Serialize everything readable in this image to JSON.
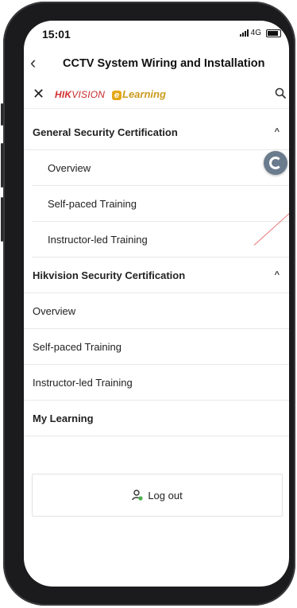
{
  "status_bar": {
    "time": "15:01",
    "network": "4G"
  },
  "header": {
    "title": "CCTV System Wiring and Installation",
    "back_icon": "chevron-left-icon"
  },
  "brand_bar": {
    "close_icon": "close-icon",
    "brand_hik_bold": "HIK",
    "brand_hik_rest": "VISION",
    "brand_elearning_prefix": "e",
    "brand_elearning": "Learning",
    "search_icon": "search-icon"
  },
  "menu": {
    "general": {
      "label": "General Security Certification",
      "caret": "^",
      "items": [
        "Overview",
        "Self-paced Training",
        "Instructor-led Training"
      ]
    },
    "hikvision": {
      "label": "Hikvision Security Certification",
      "caret": "^",
      "items": [
        "Overview",
        "Self-paced Training",
        "Instructor-led Training"
      ]
    },
    "my_learning": {
      "label": "My Learning"
    }
  },
  "logout": {
    "label": "Log out",
    "icon": "user-logout-icon"
  },
  "colors": {
    "brand_red": "#d32f2f",
    "brand_gold": "#e6a817",
    "float_button": "#6a7b8d"
  }
}
